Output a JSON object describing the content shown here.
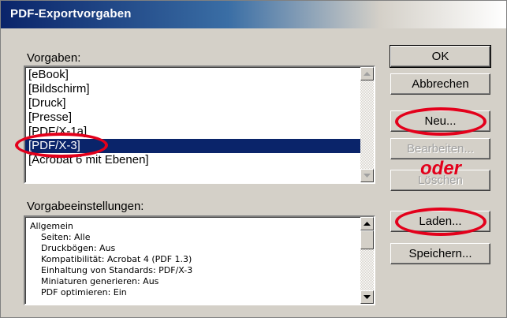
{
  "window": {
    "title": "PDF-Exportvorgaben"
  },
  "presets": {
    "label": "Vorgaben:",
    "items": [
      "[eBook]",
      "[Bildschirm]",
      "[Druck]",
      "[Presse]",
      "[PDF/X-1a]",
      "[PDF/X-3]",
      "[Acrobat 6 mit Ebenen]"
    ],
    "selected": "[PDF/X-3]"
  },
  "settings": {
    "label": "Vorgabeeinstellungen:",
    "lines": [
      "Allgemein",
      "Seiten: Alle",
      "Druckbögen: Aus",
      "Kompatibilität: Acrobat 4 (PDF 1.3)",
      "Einhaltung von Standards: PDF/X-3",
      "Miniaturen generieren: Aus",
      "PDF optimieren: Ein"
    ]
  },
  "buttons": {
    "ok": "OK",
    "cancel": "Abbrechen",
    "new": "Neu...",
    "edit": "Bearbeiten...",
    "delete": "Löschen",
    "load": "Laden...",
    "save": "Speichern..."
  },
  "annotation": {
    "text": "oder",
    "color": "#e3001b"
  },
  "colors": {
    "selection": "#0a246a",
    "dialog": "#d4d0c8",
    "title_bar": "#0a246a"
  }
}
